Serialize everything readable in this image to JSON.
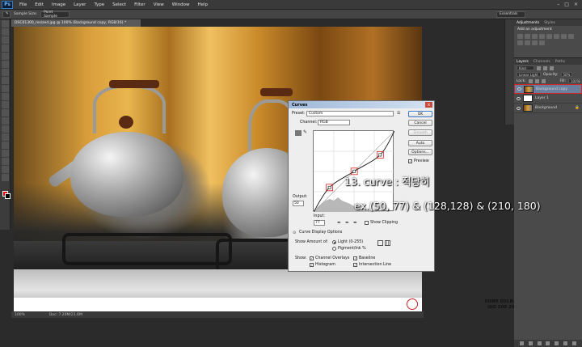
{
  "app": {
    "logo": "Ps",
    "menu": [
      "File",
      "Edit",
      "Image",
      "Layer",
      "Type",
      "Select",
      "Filter",
      "View",
      "Window",
      "Help"
    ],
    "window_controls": [
      "–",
      "□",
      "×"
    ]
  },
  "options_bar": {
    "sample_size_label": "Sample Size:",
    "sample_size_value": "Point Sample",
    "workspace": "Essentials"
  },
  "document": {
    "tab_title": "DSC01300_resized.jpg @ 100% (Background copy, RGB/16) *",
    "caption_line1": "SONY DSLR-A850 2013-10-14",
    "caption_line2": "ISO 200 200mm F3.5 1/320s",
    "zoom": "100%",
    "doc_info": "Doc: 7.20M/21.6M"
  },
  "adjustments_panel": {
    "tabs": [
      "Adjustments",
      "Styles"
    ],
    "add_label": "Add an adjustment"
  },
  "layers_panel": {
    "tabs": [
      "Layers",
      "Channels",
      "Paths"
    ],
    "kind_label": "Kind",
    "blend_mode": "Linear Light",
    "opacity_label": "Opacity:",
    "opacity_value": "50%",
    "lock_label": "Lock:",
    "fill_label": "Fill:",
    "fill_value": "100%",
    "layers": [
      {
        "name": "Background copy",
        "selected": true
      },
      {
        "name": "Layer 1",
        "selected": false
      },
      {
        "name": "Background",
        "selected": false
      }
    ]
  },
  "curves": {
    "title": "Curves",
    "preset_label": "Preset:",
    "preset_value": "Custom",
    "channel_label": "Channel:",
    "channel_value": "RGB",
    "buttons": {
      "ok": "OK",
      "cancel": "Cancel",
      "smooth": "Smooth",
      "auto": "Auto",
      "options": "Options..."
    },
    "preview_label": "Preview",
    "output_label": "Output:",
    "output_value": "50",
    "input_label": "Input:",
    "input_value": "77",
    "show_clipping_label": "Show Clipping",
    "display_options_label": "Curve Display Options",
    "show_amount_label": "Show Amount of:",
    "light_label": "Light  (0-255)",
    "pigment_label": "Pigment/Ink %",
    "show_label": "Show:",
    "channel_overlays_label": "Channel Overlays",
    "baseline_label": "Baseline",
    "histogram_label": "Histogram",
    "intersection_label": "Intersection Line"
  },
  "annotation": {
    "line1": "13. curve : 적당히",
    "line2": "ex.(50, 77) & (128,128) & (210, 180)"
  },
  "chart_data": {
    "type": "line",
    "x": [
      0,
      50,
      128,
      210,
      255
    ],
    "y": [
      0,
      77,
      128,
      180,
      255
    ],
    "control_points": [
      [
        50,
        77
      ],
      [
        128,
        128
      ],
      [
        210,
        180
      ]
    ],
    "xlim": [
      0,
      255
    ],
    "ylim": [
      0,
      255
    ]
  }
}
